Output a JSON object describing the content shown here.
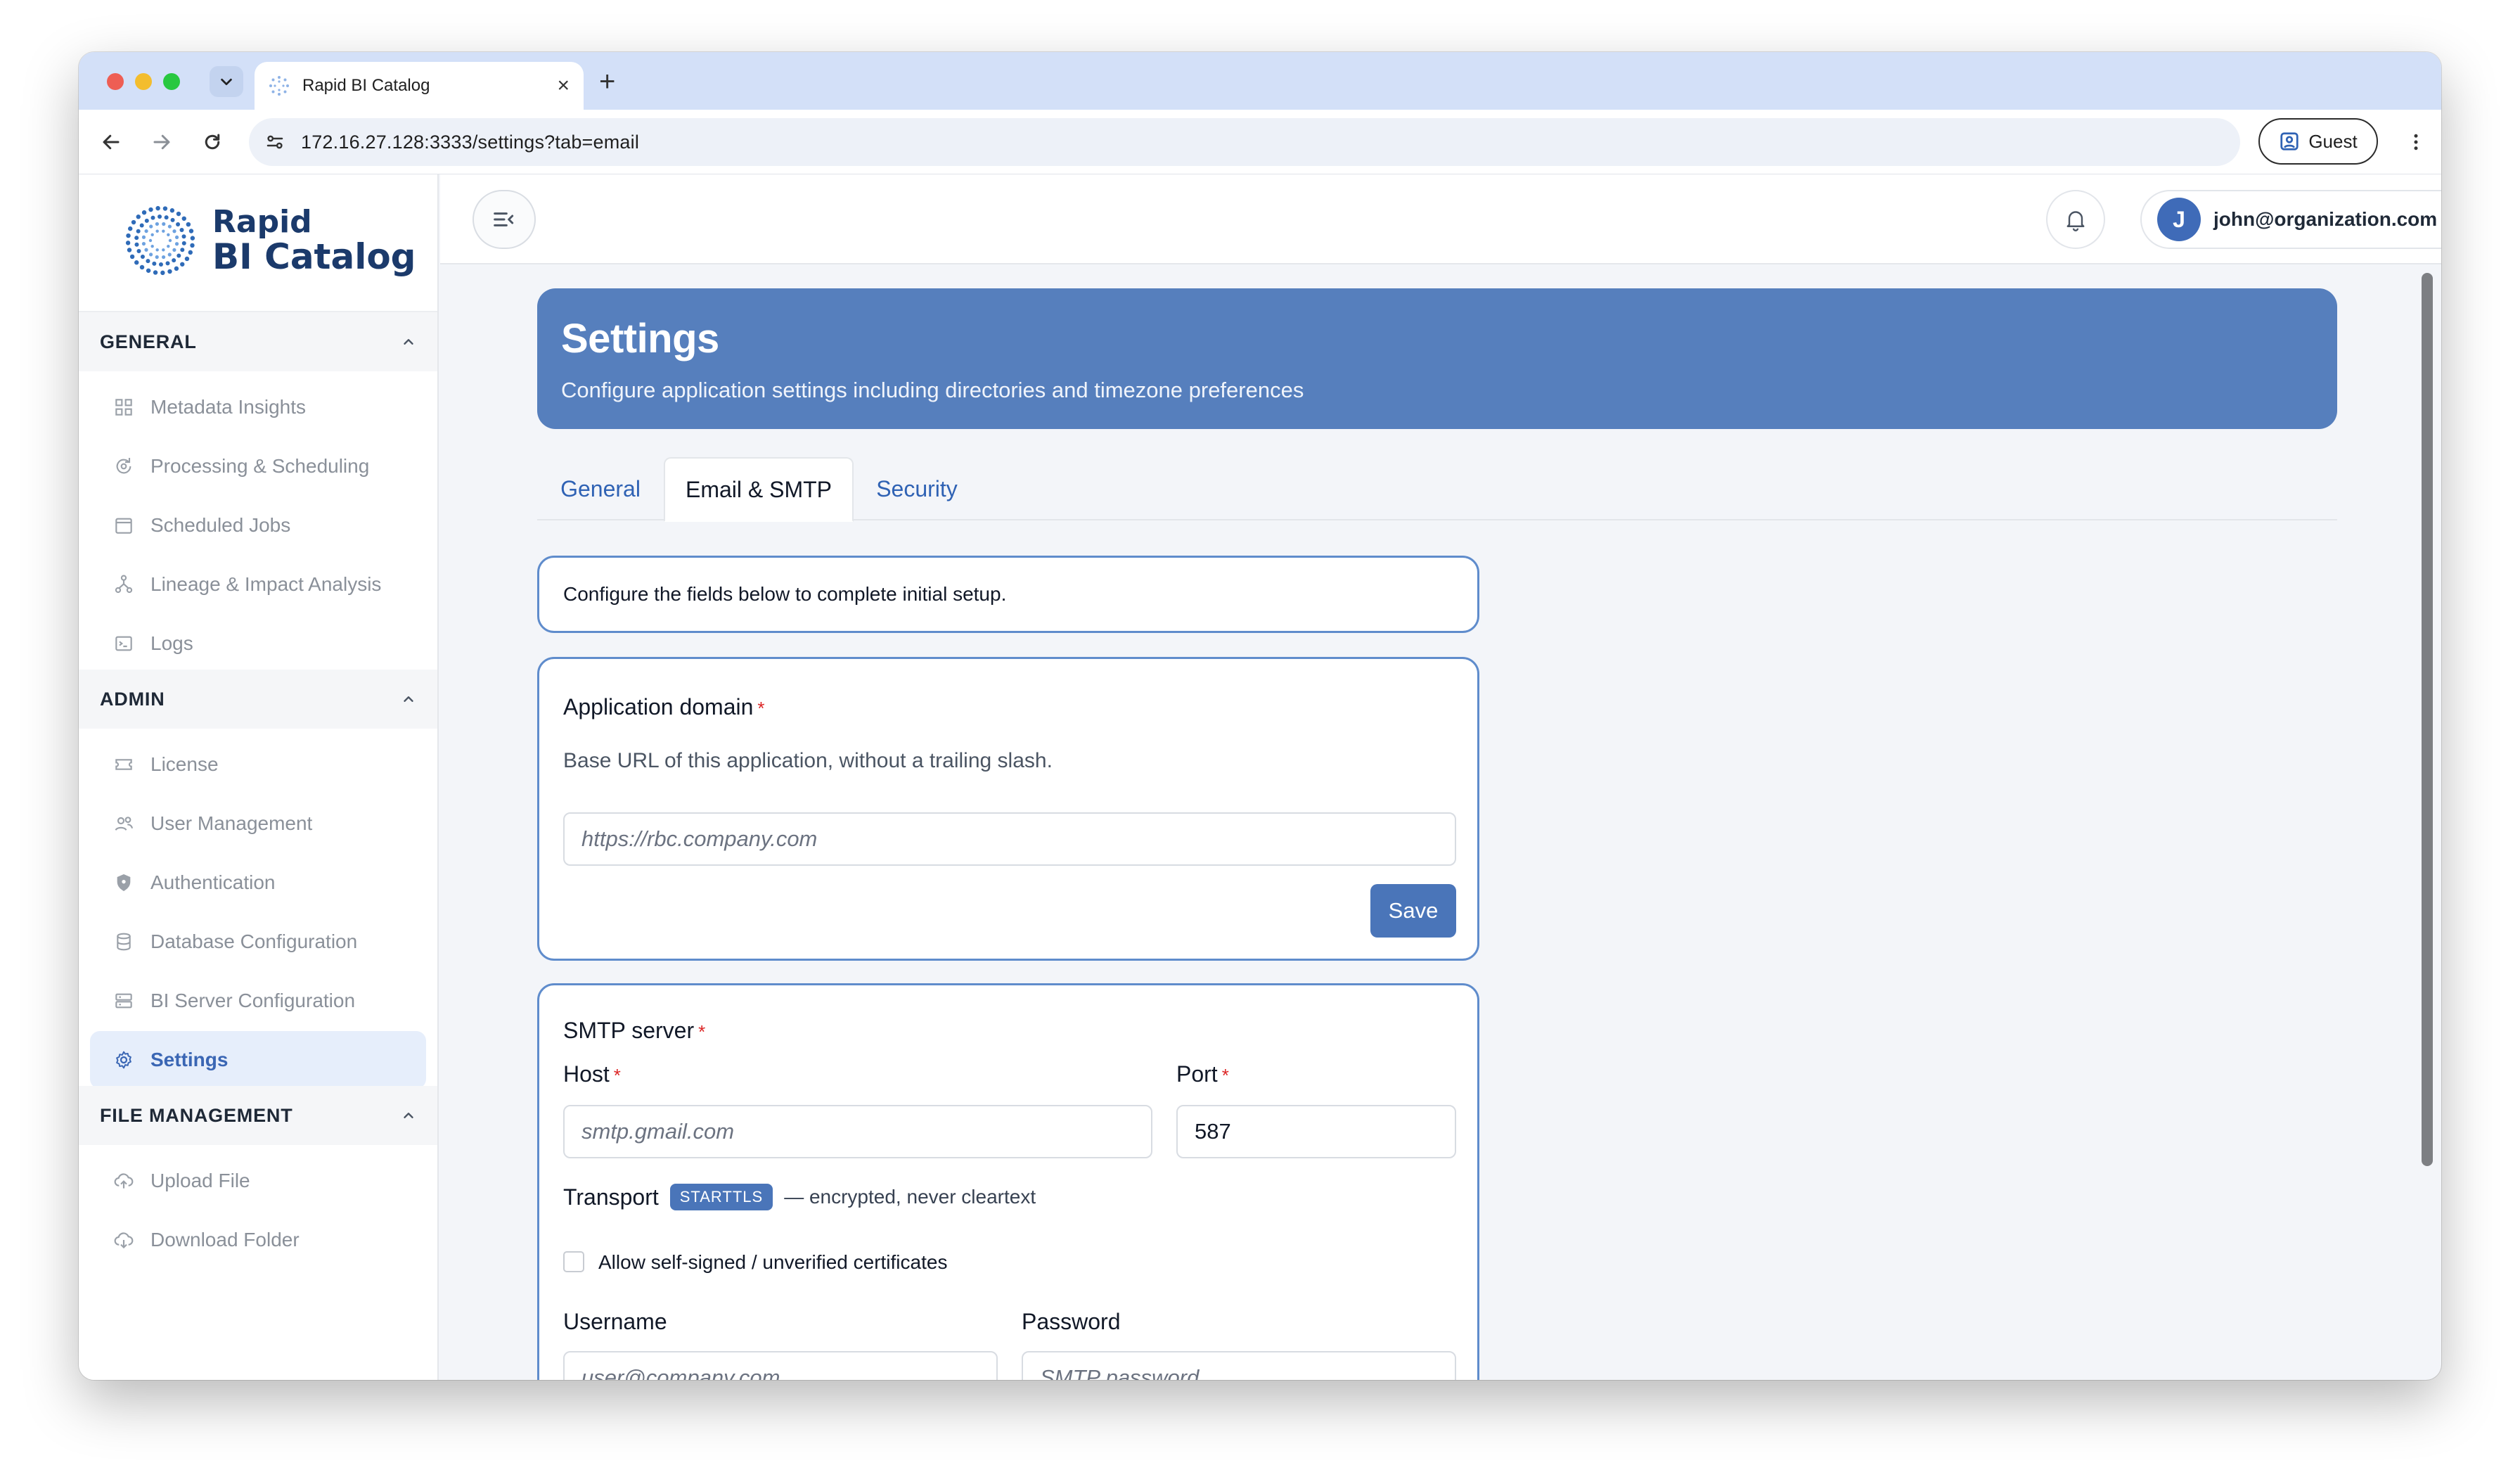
{
  "browser": {
    "tab_title": "Rapid BI Catalog",
    "url": "172.16.27.128:3333/settings?tab=email",
    "profile_label": "Guest"
  },
  "brand": {
    "line1": "Rapid",
    "line2": "BI Catalog"
  },
  "sidebar": {
    "sections": [
      {
        "title": "GENERAL",
        "items": [
          {
            "label": "Metadata Insights",
            "icon": "grid-icon"
          },
          {
            "label": "Processing & Scheduling",
            "icon": "refresh-icon"
          },
          {
            "label": "Scheduled Jobs",
            "icon": "calendar-icon"
          },
          {
            "label": "Lineage & Impact Analysis",
            "icon": "lineage-icon"
          },
          {
            "label": "Logs",
            "icon": "terminal-icon"
          }
        ]
      },
      {
        "title": "ADMIN",
        "items": [
          {
            "label": "License",
            "icon": "ticket-icon"
          },
          {
            "label": "User Management",
            "icon": "users-icon"
          },
          {
            "label": "Authentication",
            "icon": "shield-icon"
          },
          {
            "label": "Database Configuration",
            "icon": "database-icon"
          },
          {
            "label": "BI Server Configuration",
            "icon": "server-icon"
          },
          {
            "label": "Settings",
            "icon": "gear-icon",
            "active": true
          }
        ]
      },
      {
        "title": "FILE MANAGEMENT",
        "items": [
          {
            "label": "Upload File",
            "icon": "cloud-upload-icon"
          },
          {
            "label": "Download Folder",
            "icon": "cloud-download-icon"
          }
        ]
      }
    ]
  },
  "header": {
    "user_initial": "J",
    "user_email": "john@organization.com"
  },
  "page": {
    "title": "Settings",
    "subtitle": "Configure application settings including directories and timezone preferences",
    "tabs": [
      {
        "label": "General",
        "selected": false
      },
      {
        "label": "Email & SMTP",
        "selected": true
      },
      {
        "label": "Security",
        "selected": false
      }
    ],
    "notice": "Configure the fields below to complete initial setup.",
    "app_domain": {
      "title": "Application domain",
      "required_mark": "*",
      "help": "Base URL of this application, without a trailing slash.",
      "placeholder": "https://rbc.company.com",
      "value": "",
      "save_label": "Save"
    },
    "smtp": {
      "title": "SMTP server",
      "required_mark": "*",
      "host_label": "Host",
      "host_placeholder": "smtp.gmail.com",
      "port_label": "Port",
      "port_value": "587",
      "transport_label": "Transport",
      "transport_badge": "STARTTLS",
      "transport_note": "— encrypted, never cleartext",
      "self_signed_label": "Allow self-signed / unverified certificates",
      "self_signed_checked": false,
      "username_label": "Username",
      "username_placeholder": "user@company.com",
      "password_label": "Password",
      "password_placeholder": "SMTP password"
    }
  },
  "colors": {
    "accent": "#567fbd",
    "button": "#4a75b9",
    "required": "#dc2626",
    "brand_text": "#1b3a6b"
  }
}
